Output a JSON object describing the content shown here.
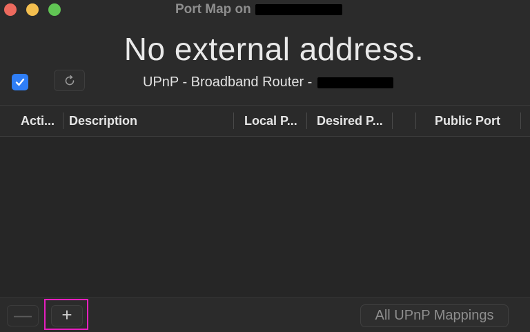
{
  "window": {
    "title": "Port Map on"
  },
  "status": {
    "headline": "No external address.",
    "router_label": "UPnP - Broadband Router -"
  },
  "controls": {
    "enable_checked": true
  },
  "table": {
    "columns": [
      "Acti...",
      "Description",
      "Local P...",
      "Desired P...",
      "",
      "Public Port"
    ],
    "rows": []
  },
  "bottom": {
    "remove_label": "—",
    "add_label": "+",
    "mappings_label": "All UPnP Mappings"
  },
  "colors": {
    "accent": "#2f7ef6",
    "highlight": "#e61fbf"
  }
}
